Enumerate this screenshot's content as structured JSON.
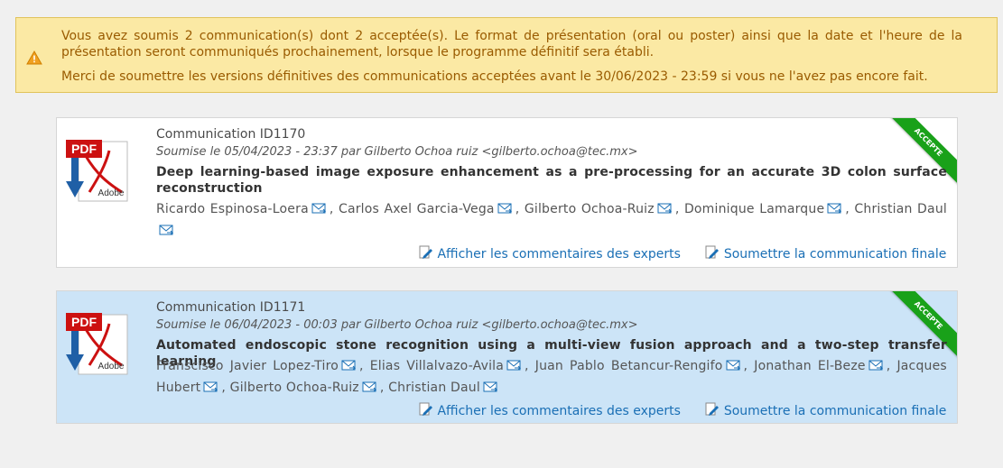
{
  "alert": {
    "line1": "Vous avez soumis 2 communication(s) dont 2 acceptée(s). Le format de présentation (oral ou poster) ainsi que la date et l'heure de la présentation seront communiqués prochainement, lorsque le programme définitif sera établi.",
    "line2": "Merci de soumettre les versions définitives des communications acceptées avant le 30/06/2023 - 23:59 si vous ne l'avez pas encore fait.",
    "icon": "warning-icon",
    "color_bg": "#fbe9a4",
    "color_text": "#9a5b00"
  },
  "communications": [
    {
      "id_label": "Communication ID1170",
      "submitted": "Soumise le 05/04/2023 - 23:37 par Gilberto Ochoa ruiz <gilberto.ochoa@tec.mx>",
      "title": "Deep learning-based image exposure enhancement as a pre-processing for an accurate 3D colon surface reconstruction",
      "authors": [
        "Ricardo Espinosa-Loera",
        "Carlos Axel Garcia-Vega",
        "Gilberto Ochoa-Ruiz",
        "Dominique Lamarque",
        "Christian Daul"
      ],
      "status": "ACCEPTE",
      "action_comments": "Afficher les commentaires des experts",
      "action_submit": "Soumettre la communication finale",
      "pdf_text": "PDF",
      "pdf_brand": "Adobe"
    },
    {
      "id_label": "Communication ID1171",
      "submitted": "Soumise le 06/04/2023 - 00:03 par Gilberto Ochoa ruiz <gilberto.ochoa@tec.mx>",
      "title": "Automated endoscopic stone recognition using a multi-view fusion approach and a two-step transfer learning",
      "authors": [
        "Franscisco Javier Lopez-Tiro",
        "Elias Villalvazo-Avila",
        "Juan Pablo Betancur-Rengifo",
        "Jonathan El-Beze",
        "Jacques Hubert",
        "Gilberto Ochoa-Ruiz",
        "Christian Daul"
      ],
      "status": "ACCEPTE",
      "action_comments": "Afficher les commentaires des experts",
      "action_submit": "Soumettre la communication finale",
      "pdf_text": "PDF",
      "pdf_brand": "Adobe"
    }
  ],
  "colors": {
    "ribbon": "#19a119",
    "link": "#1a6fb5",
    "card2_bg": "#cce4f7"
  }
}
